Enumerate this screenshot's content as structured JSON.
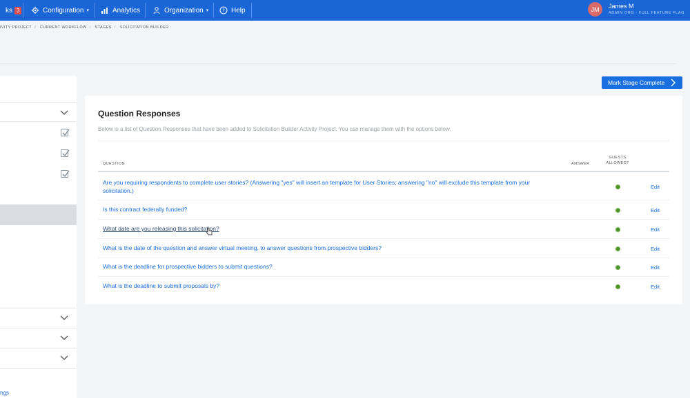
{
  "nav": {
    "partial_label": "ks",
    "badge": "3",
    "configuration": "Configuration",
    "analytics": "Analytics",
    "organization": "Organization",
    "help": "Help",
    "user": {
      "initials": "JM",
      "name": "James M",
      "role": "ADMIN ORG - FULL FEATURE FLAG"
    }
  },
  "breadcrumb": [
    "IVITY PROJECT",
    "CURRENT WORKFLOW",
    "STAGES",
    "SOLICITATION BUILDER"
  ],
  "left_panel": {
    "link_partial": "ngs"
  },
  "mark_complete_label": "Mark Stage Complete",
  "card": {
    "title": "Question Responses",
    "description": "Below is a list of Question Responses that have been added to Solicitation Builder Activity Project. You can manage them with the options below.",
    "columns": {
      "question": "QUESTION",
      "answer": "ANSWER",
      "guests_allowed_1": "GUESTS",
      "guests_allowed_2": "ALLOWED?"
    },
    "rows": [
      {
        "question": "Are you requiring respondents to complete user stories? (Answering \"yes\" will insert an template for User Stories; answering \"no\" will exclude this template from your solicitation.)",
        "guests_allowed": true,
        "action": "Edit"
      },
      {
        "question": "Is this contract federally funded?",
        "guests_allowed": true,
        "action": "Edit"
      },
      {
        "question": "What date are you releasing this solicitation?",
        "guests_allowed": true,
        "action": "Edit"
      },
      {
        "question": "What is the date of the question and answer virtual meeting, to answer questions from prospective bidders?",
        "guests_allowed": true,
        "action": "Edit"
      },
      {
        "question": "What is the deadline for prospective bidders to submit questions?",
        "guests_allowed": true,
        "action": "Edit"
      },
      {
        "question": "What is the deadline to submit proposals by?",
        "guests_allowed": true,
        "action": "Edit"
      }
    ]
  },
  "colors": {
    "primary": "#1a66d6",
    "status_dot": "#4a8f2a",
    "avatar": "#d86a6a"
  }
}
